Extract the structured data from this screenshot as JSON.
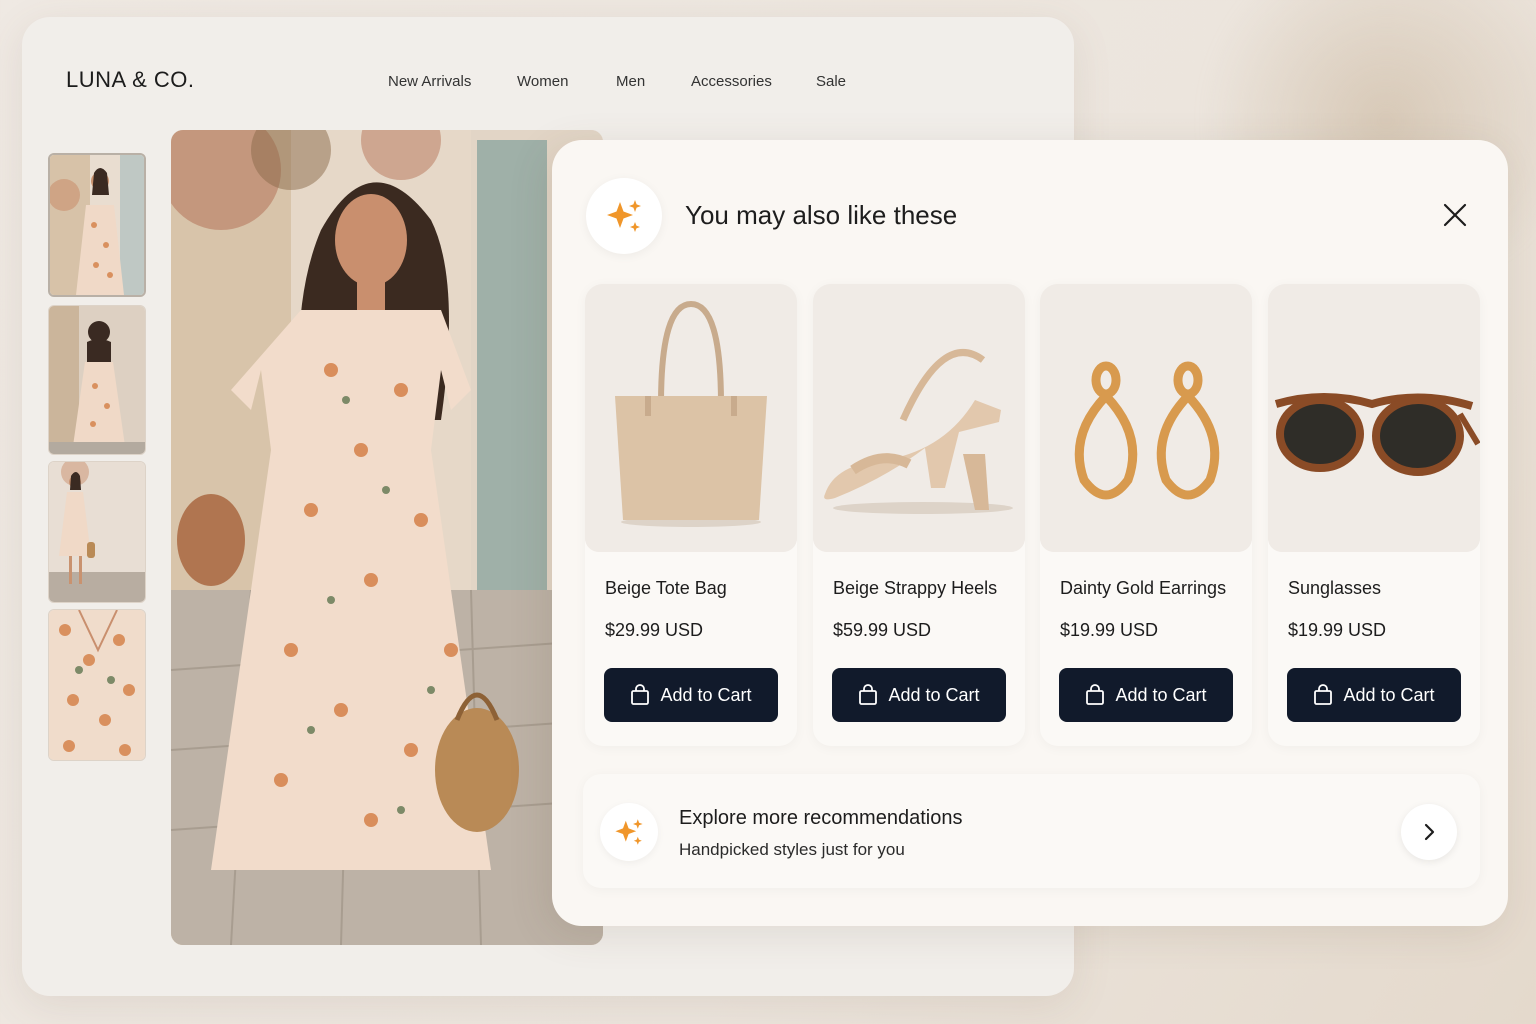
{
  "store": {
    "logo": "LUNA & CO.",
    "nav": [
      "New Arrivals",
      "Women",
      "Men",
      "Accessories",
      "Sale"
    ]
  },
  "gallery": {
    "thumbnails": [
      "dress-front",
      "dress-back",
      "dress-full",
      "dress-detail"
    ],
    "main_image": "floral-dress-model"
  },
  "recommendations": {
    "title": "You may also like these",
    "icon": "sparkle-icon",
    "accent_color": "#f0962a",
    "button_color": "#111a2b",
    "products": [
      {
        "name": "Beige Tote Bag",
        "price": "$29.99 USD",
        "button": "Add to Cart",
        "image": "tote-bag"
      },
      {
        "name": "Beige Strappy Heels",
        "price": "$59.99 USD",
        "button": "Add to Cart",
        "image": "strappy-heels"
      },
      {
        "name": "Dainty Gold Earrings",
        "price": "$19.99 USD",
        "button": "Add to Cart",
        "image": "gold-earrings"
      },
      {
        "name": "Sunglasses",
        "price": "$19.99 USD",
        "button": "Add to Cart",
        "image": "sunglasses"
      }
    ],
    "explore": {
      "title": "Explore more recommendations",
      "subtitle": "Handpicked styles just for you"
    }
  }
}
